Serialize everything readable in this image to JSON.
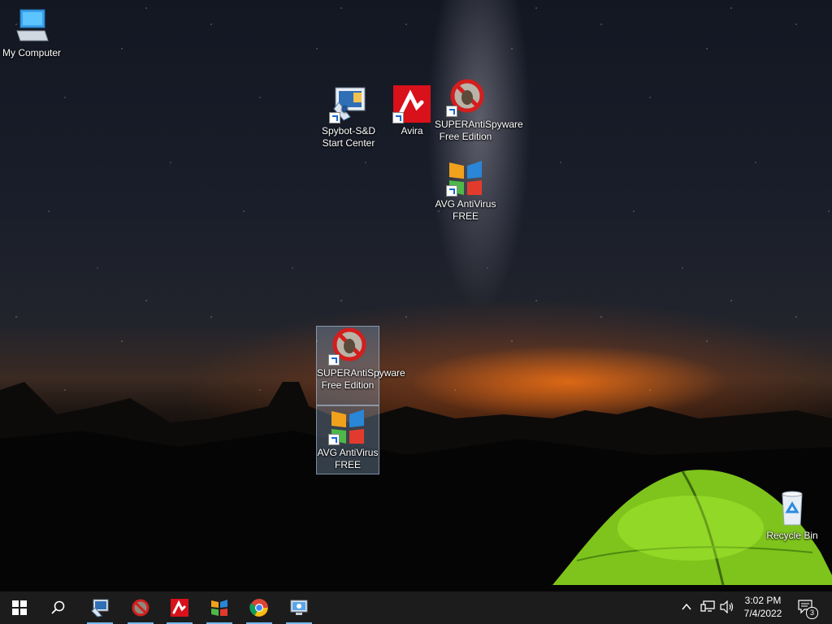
{
  "desktop": {
    "icons": [
      {
        "label": "My Computer"
      },
      {
        "label": "Spybot-S&D Start Center"
      },
      {
        "label": "Avira"
      },
      {
        "label": "SUPERAntiSpyware Free Edition"
      },
      {
        "label": "AVG AntiVirus FREE"
      },
      {
        "label": "SUPERAntiSpyware Free Edition"
      },
      {
        "label": "AVG AntiVirus FREE"
      },
      {
        "label": "Recycle Bin"
      }
    ]
  },
  "taskbar": {
    "start_icon": "windows-logo-icon",
    "search_icon": "search-icon",
    "pinned": [
      "spybot-icon",
      "superantispyware-icon",
      "avira-icon",
      "avg-icon",
      "chrome-icon",
      "pc-monitor-icon"
    ],
    "clock": {
      "time": "3:02 PM",
      "date": "7/4/2022"
    },
    "notifications_count": "3",
    "accent": "#76b9ed"
  }
}
